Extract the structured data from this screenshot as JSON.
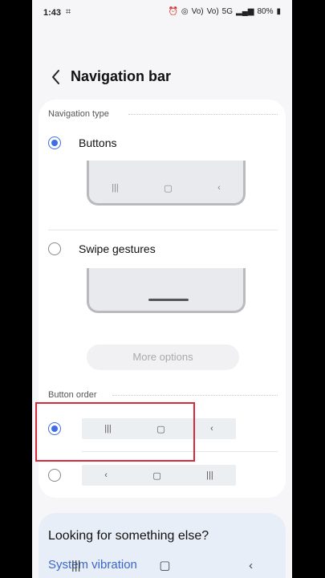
{
  "status_bar": {
    "time": "1:43",
    "left_icon": "screenshot-icon",
    "right_icons": [
      "alarm-icon",
      "hotspot-icon",
      "volte-icon",
      "volte-icon",
      "5g-icon",
      "signal-icon"
    ],
    "battery": "80%",
    "volte1": "Vo)",
    "volte2": "Vo)",
    "tag_5g": "5G"
  },
  "header": {
    "title": "Navigation bar"
  },
  "navigation_type": {
    "label": "Navigation type",
    "options": [
      {
        "label": "Buttons",
        "checked": true
      },
      {
        "label": "Swipe gestures",
        "checked": false
      }
    ],
    "preview_buttons": [
      "|||",
      "▢",
      "‹"
    ]
  },
  "more_options": "More options",
  "button_order": {
    "label": "Button order",
    "orders": [
      {
        "checked": true,
        "buttons": [
          "|||",
          "▢",
          "‹"
        ]
      },
      {
        "checked": false,
        "buttons": [
          "‹",
          "▢",
          "|||"
        ]
      }
    ]
  },
  "bottom": {
    "title": "Looking for something else?",
    "link": "System vibration"
  },
  "nav_bar": [
    "|||",
    "▢",
    "‹"
  ],
  "colors": {
    "accent": "#3e6ee0",
    "highlight": "#d52a3a",
    "link": "#3b67c6"
  }
}
